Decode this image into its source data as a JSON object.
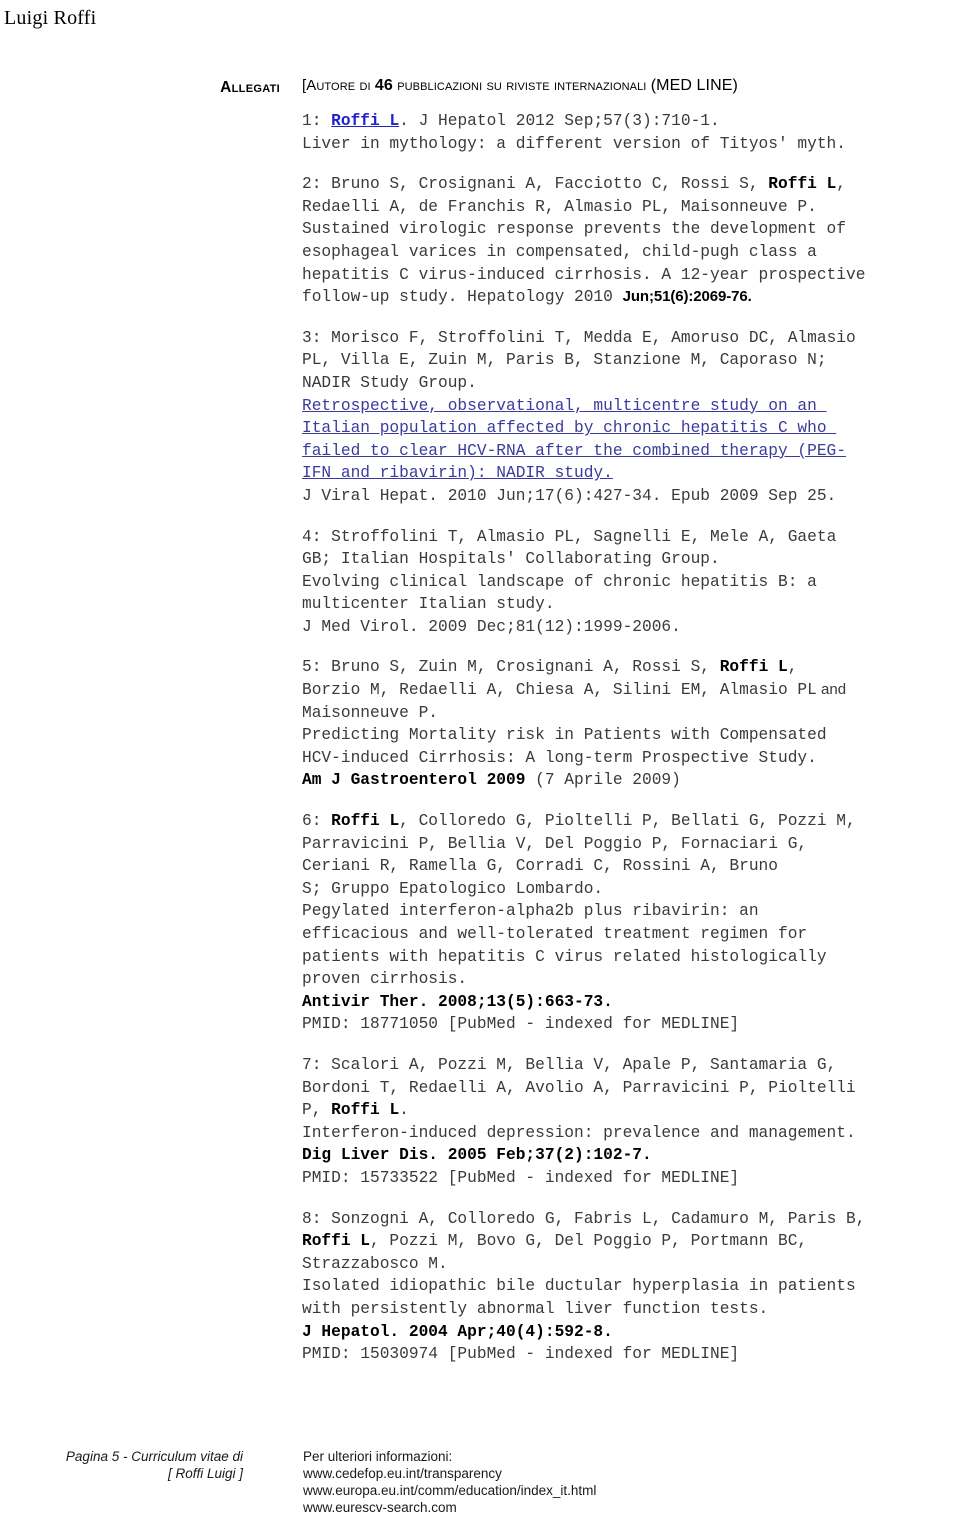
{
  "header": {
    "running_title": "Luigi Roffi"
  },
  "section": {
    "label": "Allegati",
    "subtitle_prefix": "[Autore di ",
    "subtitle_count": "46",
    "subtitle_middle": " pubblicazioni su riviste internazionali ",
    "subtitle_suffix": "(MED LINE)"
  },
  "publications": [
    {
      "index": "1:",
      "authors_link": "Roffi L",
      "authors_rest": ". J Hepatol 2012 Sep;57(3):710-1.",
      "title": "Liver in mythology: a different version of Tityos' myth."
    },
    {
      "index": "2:",
      "authors_pre": " Bruno S, Crosignani A, Facciotto C, Rossi S, ",
      "authors_bold": "Roffi L",
      "authors_post": ",\nRedaelli A, de Franchis R, Almasio PL, Maisonneuve P.",
      "title": "Sustained virologic response prevents the development of\nesophageal varices in compensated, child-pugh class a\nhepatitis C virus-induced cirrhosis. A 12-year prospective\nfollow-up study. Hepatology 2010 ",
      "journal_alt": "Jun;51(6):2069-76."
    },
    {
      "index": "3:",
      "authors": " Morisco F, Stroffolini T, Medda E, Amoruso DC, Almasio\nPL, Villa E, Zuin M, Paris B, Stanzione M, Caporaso N;\nNADIR Study Group.",
      "title_link": "Retrospective, observational, multicentre study on an \nItalian population affected by chronic hepatitis C who \nfailed to clear HCV-RNA after the combined therapy (PEG-\nIFN and ribavirin): NADIR study.",
      "journal": "J Viral Hepat. 2010 Jun;17(6):427-34. Epub 2009 Sep 25."
    },
    {
      "index": "4:",
      "authors": " Stroffolini T, Almasio PL, Sagnelli E, Mele A, Gaeta\nGB; Italian Hospitals' Collaborating Group.",
      "title": "Evolving clinical landscape of chronic hepatitis B: a\nmulticenter Italian study.",
      "journal": "J Med Virol. 2009 Dec;81(12):1999-2006."
    },
    {
      "index": "5:",
      "authors_pre": " Bruno S, Zuin M, Crosignani A, Rossi S, ",
      "authors_bold": "Roffi L",
      "authors_post": ",\nBorzio M, Redaelli A, Chiesa A, Silini EM, Almasio PL",
      "authors_alt": " and",
      "authors_post2": "\nMaisonneuve P.",
      "title": "Predicting Mortality risk in Patients with Compensated\nHCV-induced Cirrhosis: A long-term Prospective Study.",
      "journal_bold": "Am J Gastroenterol 2009",
      "journal_rest": " (7 Aprile 2009)"
    },
    {
      "index": "6:",
      "authors_bold": "Roffi L",
      "authors_post": ", Colloredo G, Pioltelli P, Bellati G, Pozzi M,\nParravicini P, Bellia V, Del Poggio P, Fornaciari G,\nCeriani R, Ramella G, Corradi C, Rossini A, Bruno\nS; Gruppo Epatologico Lombardo.",
      "title": "Pegylated interferon-alpha2b plus ribavirin: an\nefficacious and well-tolerated treatment regimen for\npatients with hepatitis C virus related histologically\nproven cirrhosis.",
      "journal_bold": "Antivir Ther. 2008;13(5):663-73.",
      "pmid": "PMID: 18771050 [PubMed - indexed for MEDLINE]"
    },
    {
      "index": "7:",
      "authors_pre": " Scalori A, Pozzi M, Bellia V, Apale P, Santamaria G,\nBordoni T, Redaelli A, Avolio A, Parravicini P, Pioltelli\nP, ",
      "authors_bold": "Roffi L",
      "authors_post": ".",
      "title": "Interferon-induced depression: prevalence and management.",
      "journal_bold": "Dig Liver Dis. 2005 Feb;37(2):102-7.",
      "pmid": "PMID: 15733522 [PubMed - indexed for MEDLINE]"
    },
    {
      "index": "8:",
      "authors_pre": " Sonzogni A, Colloredo G, Fabris L, Cadamuro M, Paris B,\n",
      "authors_bold": "Roffi L",
      "authors_post": ", Pozzi M, Bovo G, Del Poggio P, Portmann BC,\nStrazzabosco M.",
      "title": "Isolated idiopathic bile ductular hyperplasia in patients\nwith persistently abnormal liver function tests.",
      "journal_bold": "J Hepatol. 2004 Apr;40(4):592-8.",
      "pmid": "PMID: 15030974 [PubMed - indexed for MEDLINE]"
    }
  ],
  "footer": {
    "left_line1": "Pagina 5 - Curriculum vitae di",
    "left_line2": "[ Roffi Luigi ]",
    "right_line1": "Per ulteriori informazioni:",
    "right_line2": "www.cedefop.eu.int/transparency",
    "right_line3": "www.europa.eu.int/comm/education/index_it.html",
    "right_line4": "www.eurescv-search.com"
  },
  "colors": {
    "link_blue": "#2222cc",
    "title_link_blue": "#3b3b9e",
    "body_text": "#3a3a3a"
  }
}
